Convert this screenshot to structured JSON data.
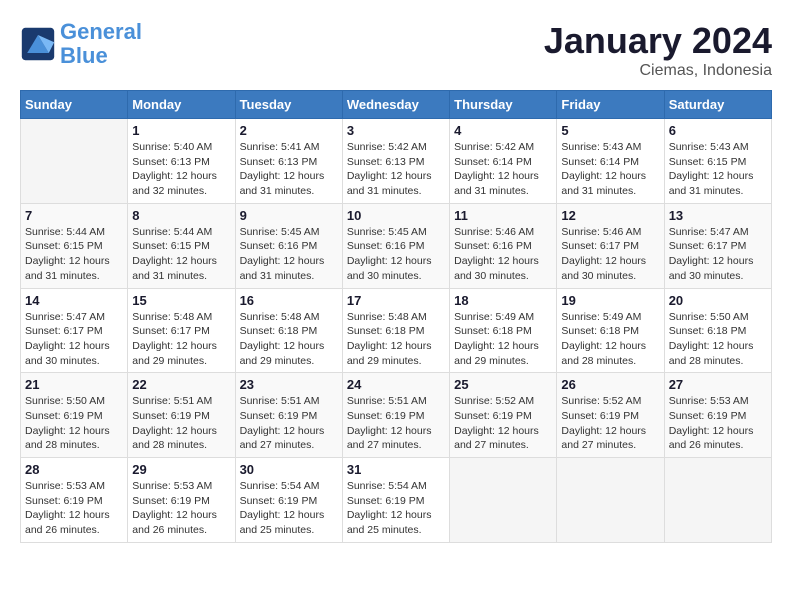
{
  "header": {
    "logo_line1": "General",
    "logo_line2": "Blue",
    "month": "January 2024",
    "location": "Ciemas, Indonesia"
  },
  "days_of_week": [
    "Sunday",
    "Monday",
    "Tuesday",
    "Wednesday",
    "Thursday",
    "Friday",
    "Saturday"
  ],
  "weeks": [
    [
      {
        "day": "",
        "info": ""
      },
      {
        "day": "1",
        "info": "Sunrise: 5:40 AM\nSunset: 6:13 PM\nDaylight: 12 hours\nand 32 minutes."
      },
      {
        "day": "2",
        "info": "Sunrise: 5:41 AM\nSunset: 6:13 PM\nDaylight: 12 hours\nand 31 minutes."
      },
      {
        "day": "3",
        "info": "Sunrise: 5:42 AM\nSunset: 6:13 PM\nDaylight: 12 hours\nand 31 minutes."
      },
      {
        "day": "4",
        "info": "Sunrise: 5:42 AM\nSunset: 6:14 PM\nDaylight: 12 hours\nand 31 minutes."
      },
      {
        "day": "5",
        "info": "Sunrise: 5:43 AM\nSunset: 6:14 PM\nDaylight: 12 hours\nand 31 minutes."
      },
      {
        "day": "6",
        "info": "Sunrise: 5:43 AM\nSunset: 6:15 PM\nDaylight: 12 hours\nand 31 minutes."
      }
    ],
    [
      {
        "day": "7",
        "info": "Sunrise: 5:44 AM\nSunset: 6:15 PM\nDaylight: 12 hours\nand 31 minutes."
      },
      {
        "day": "8",
        "info": "Sunrise: 5:44 AM\nSunset: 6:15 PM\nDaylight: 12 hours\nand 31 minutes."
      },
      {
        "day": "9",
        "info": "Sunrise: 5:45 AM\nSunset: 6:16 PM\nDaylight: 12 hours\nand 31 minutes."
      },
      {
        "day": "10",
        "info": "Sunrise: 5:45 AM\nSunset: 6:16 PM\nDaylight: 12 hours\nand 30 minutes."
      },
      {
        "day": "11",
        "info": "Sunrise: 5:46 AM\nSunset: 6:16 PM\nDaylight: 12 hours\nand 30 minutes."
      },
      {
        "day": "12",
        "info": "Sunrise: 5:46 AM\nSunset: 6:17 PM\nDaylight: 12 hours\nand 30 minutes."
      },
      {
        "day": "13",
        "info": "Sunrise: 5:47 AM\nSunset: 6:17 PM\nDaylight: 12 hours\nand 30 minutes."
      }
    ],
    [
      {
        "day": "14",
        "info": "Sunrise: 5:47 AM\nSunset: 6:17 PM\nDaylight: 12 hours\nand 30 minutes."
      },
      {
        "day": "15",
        "info": "Sunrise: 5:48 AM\nSunset: 6:17 PM\nDaylight: 12 hours\nand 29 minutes."
      },
      {
        "day": "16",
        "info": "Sunrise: 5:48 AM\nSunset: 6:18 PM\nDaylight: 12 hours\nand 29 minutes."
      },
      {
        "day": "17",
        "info": "Sunrise: 5:48 AM\nSunset: 6:18 PM\nDaylight: 12 hours\nand 29 minutes."
      },
      {
        "day": "18",
        "info": "Sunrise: 5:49 AM\nSunset: 6:18 PM\nDaylight: 12 hours\nand 29 minutes."
      },
      {
        "day": "19",
        "info": "Sunrise: 5:49 AM\nSunset: 6:18 PM\nDaylight: 12 hours\nand 28 minutes."
      },
      {
        "day": "20",
        "info": "Sunrise: 5:50 AM\nSunset: 6:18 PM\nDaylight: 12 hours\nand 28 minutes."
      }
    ],
    [
      {
        "day": "21",
        "info": "Sunrise: 5:50 AM\nSunset: 6:19 PM\nDaylight: 12 hours\nand 28 minutes."
      },
      {
        "day": "22",
        "info": "Sunrise: 5:51 AM\nSunset: 6:19 PM\nDaylight: 12 hours\nand 28 minutes."
      },
      {
        "day": "23",
        "info": "Sunrise: 5:51 AM\nSunset: 6:19 PM\nDaylight: 12 hours\nand 27 minutes."
      },
      {
        "day": "24",
        "info": "Sunrise: 5:51 AM\nSunset: 6:19 PM\nDaylight: 12 hours\nand 27 minutes."
      },
      {
        "day": "25",
        "info": "Sunrise: 5:52 AM\nSunset: 6:19 PM\nDaylight: 12 hours\nand 27 minutes."
      },
      {
        "day": "26",
        "info": "Sunrise: 5:52 AM\nSunset: 6:19 PM\nDaylight: 12 hours\nand 27 minutes."
      },
      {
        "day": "27",
        "info": "Sunrise: 5:53 AM\nSunset: 6:19 PM\nDaylight: 12 hours\nand 26 minutes."
      }
    ],
    [
      {
        "day": "28",
        "info": "Sunrise: 5:53 AM\nSunset: 6:19 PM\nDaylight: 12 hours\nand 26 minutes."
      },
      {
        "day": "29",
        "info": "Sunrise: 5:53 AM\nSunset: 6:19 PM\nDaylight: 12 hours\nand 26 minutes."
      },
      {
        "day": "30",
        "info": "Sunrise: 5:54 AM\nSunset: 6:19 PM\nDaylight: 12 hours\nand 25 minutes."
      },
      {
        "day": "31",
        "info": "Sunrise: 5:54 AM\nSunset: 6:19 PM\nDaylight: 12 hours\nand 25 minutes."
      },
      {
        "day": "",
        "info": ""
      },
      {
        "day": "",
        "info": ""
      },
      {
        "day": "",
        "info": ""
      }
    ]
  ]
}
